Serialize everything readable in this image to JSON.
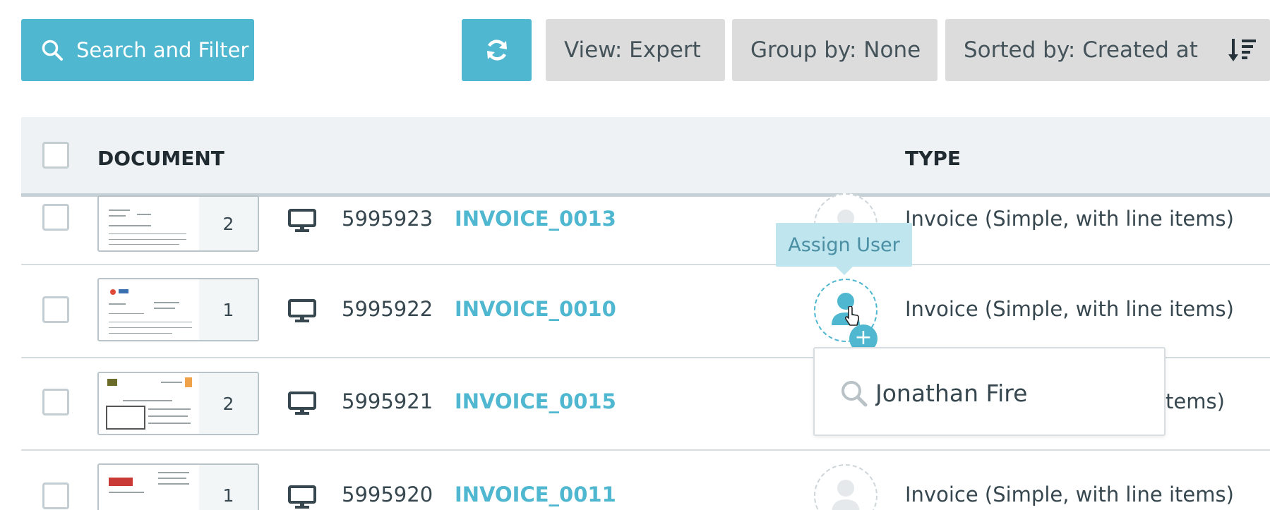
{
  "toolbar": {
    "search_filter_label": "Search and Filter",
    "view_label": "View: Expert",
    "group_label": "Group by: None",
    "sort_label": "Sorted by: Created at"
  },
  "table": {
    "columns": [
      "DOCUMENT",
      "TYPE"
    ],
    "rows": [
      {
        "pages": "2",
        "id": "5995923",
        "name": "INVOICE_0013",
        "type": "Invoice (Simple, with line items)"
      },
      {
        "pages": "1",
        "id": "5995922",
        "name": "INVOICE_0010",
        "type": "Invoice (Simple, with line items)"
      },
      {
        "pages": "2",
        "id": "5995921",
        "name": "INVOICE_0015",
        "type": "tems)"
      },
      {
        "pages": "1",
        "id": "5995920",
        "name": "INVOICE_0011",
        "type": "Invoice (Simple, with line items)"
      }
    ]
  },
  "tooltip": {
    "label": "Assign User"
  },
  "assign_dropdown": {
    "search_value": "Jonathan Fire"
  },
  "colors": {
    "accent": "#4fb7cf",
    "header_bg": "#eef2f4",
    "button_gray": "#dcdcdc",
    "tooltip_bg": "#bfe5ee"
  },
  "icons": [
    "search-icon",
    "refresh-icon",
    "sort-desc-icon",
    "monitor-icon",
    "user-icon",
    "plus-icon"
  ]
}
